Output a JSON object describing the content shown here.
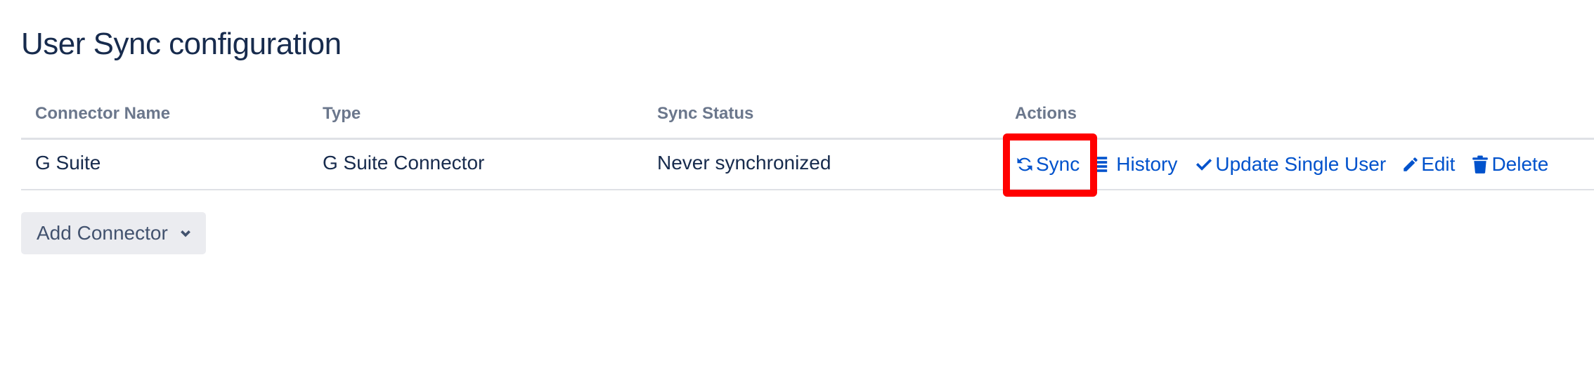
{
  "page": {
    "title": "User Sync configuration"
  },
  "table": {
    "headers": [
      "Connector Name",
      "Type",
      "Sync Status",
      "Actions"
    ],
    "rows": [
      {
        "name": "G Suite",
        "type": "G Suite Connector",
        "status": "Never synchronized",
        "actions": {
          "sync": {
            "label": "Sync",
            "icon": "sync-icon"
          },
          "history": {
            "label": "History",
            "icon": "list-icon"
          },
          "update": {
            "label": "Update Single User",
            "icon": "check-icon"
          },
          "edit": {
            "label": "Edit",
            "icon": "pencil-icon"
          },
          "delete": {
            "label": "Delete",
            "icon": "trash-icon"
          }
        }
      }
    ]
  },
  "add_connector": {
    "label": "Add Connector",
    "icon": "chevron-down-icon"
  },
  "colors": {
    "link": "#0052cc",
    "highlight": "#ff0000",
    "header_text": "#6b778c",
    "text": "#172b4d"
  }
}
